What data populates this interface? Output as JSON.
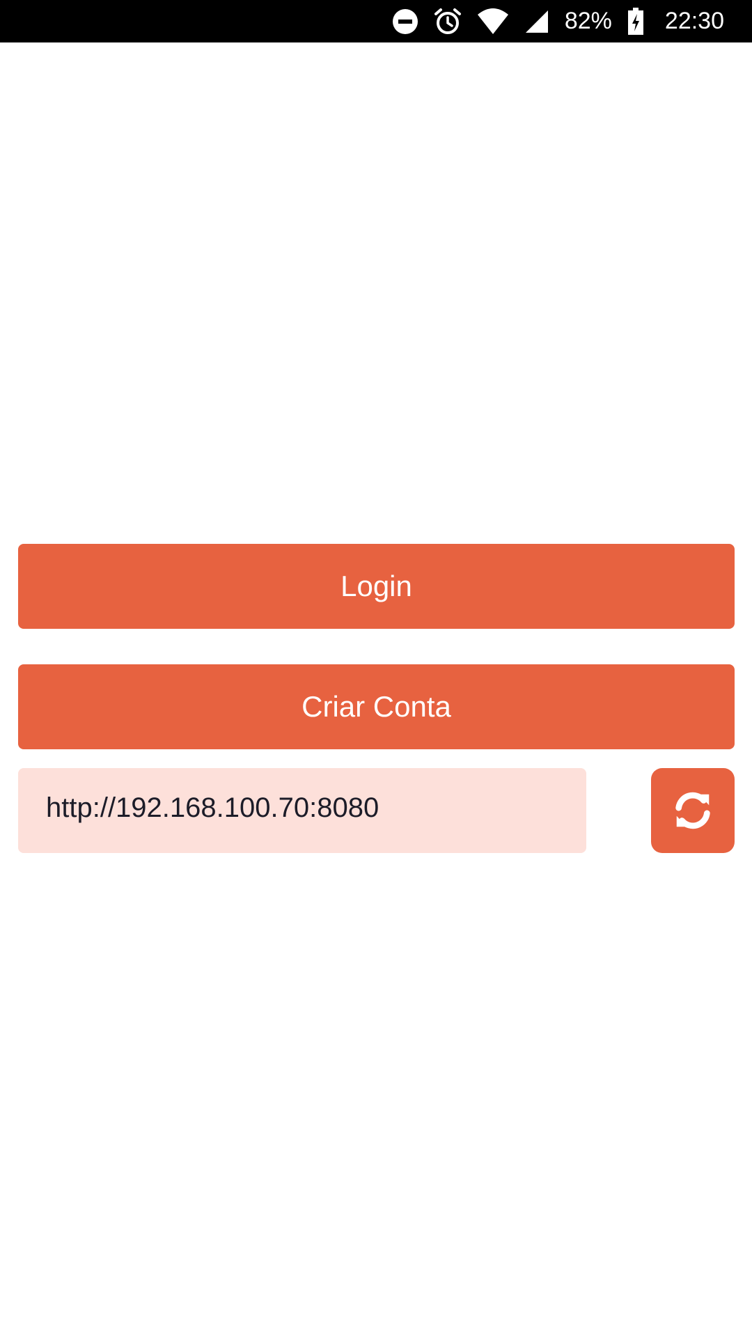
{
  "status_bar": {
    "battery_percent": "82%",
    "time": "22:30",
    "icons": [
      "do-not-disturb-icon",
      "alarm-icon",
      "wifi-icon",
      "signal-icon",
      "battery-charging-icon"
    ]
  },
  "buttons": {
    "login_label": "Login",
    "signup_label": "Criar Conta"
  },
  "server": {
    "url_value": "http://192.168.100.70:8080",
    "refresh_icon": "refresh-icon"
  },
  "colors": {
    "accent": "#e76240",
    "field_background": "#fde0da",
    "status_bar": "#000000"
  }
}
